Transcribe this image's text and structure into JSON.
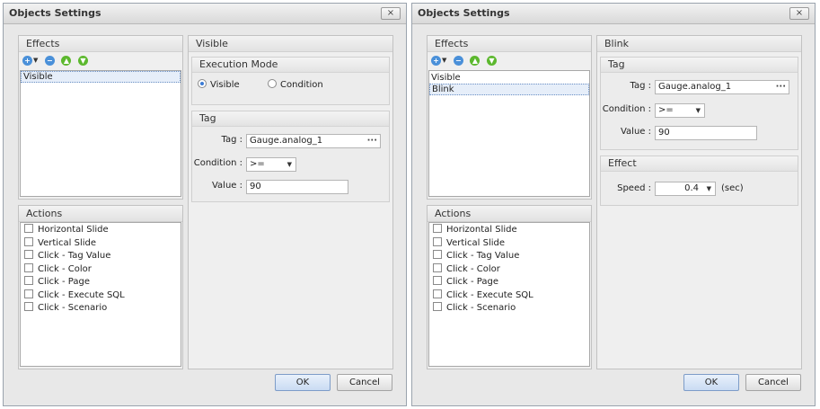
{
  "left": {
    "title": "Objects Settings",
    "close_symbol": "×",
    "effects": {
      "header": "Effects",
      "items": [
        "Visible"
      ],
      "selected_index": 0
    },
    "actions": {
      "header": "Actions",
      "items": [
        "Horizontal Slide",
        "Vertical Slide",
        "Click - Tag Value",
        "Click - Color",
        "Click - Page",
        "Click - Execute SQL",
        "Click - Scenario"
      ]
    },
    "detail": {
      "header": "Visible",
      "execution_mode": {
        "header": "Execution Mode",
        "option_visible": "Visible",
        "option_condition": "Condition",
        "selected": "Visible"
      },
      "tag": {
        "header": "Tag",
        "tag_label": "Tag :",
        "tag_value": "Gauge.analog_1",
        "ellipsis": "···",
        "condition_label": "Condition :",
        "condition_value": ">=",
        "value_label": "Value :",
        "value_value": "90"
      }
    },
    "ok_label": "OK",
    "cancel_label": "Cancel"
  },
  "right": {
    "title": "Objects Settings",
    "close_symbol": "×",
    "effects": {
      "header": "Effects",
      "items": [
        "Visible",
        "Blink"
      ],
      "selected_index": 1
    },
    "actions": {
      "header": "Actions",
      "items": [
        "Horizontal Slide",
        "Vertical Slide",
        "Click - Tag Value",
        "Click - Color",
        "Click - Page",
        "Click - Execute SQL",
        "Click - Scenario"
      ]
    },
    "detail": {
      "header": "Blink",
      "tag": {
        "header": "Tag",
        "tag_label": "Tag :",
        "tag_value": "Gauge.analog_1",
        "ellipsis": "···",
        "condition_label": "Condition :",
        "condition_value": ">=",
        "value_label": "Value :",
        "value_value": "90"
      },
      "effect": {
        "header": "Effect",
        "speed_label": "Speed :",
        "speed_value": "0.4",
        "speed_unit": "(sec)"
      }
    },
    "ok_label": "OK",
    "cancel_label": "Cancel"
  },
  "icons": {
    "add": "add-circle-icon",
    "remove": "remove-circle-icon",
    "up": "move-up-icon",
    "down": "move-down-icon"
  },
  "colors": {
    "accent_blue": "#4a90d9",
    "accent_green": "#5cb82e",
    "selection": "#e6eef9"
  }
}
